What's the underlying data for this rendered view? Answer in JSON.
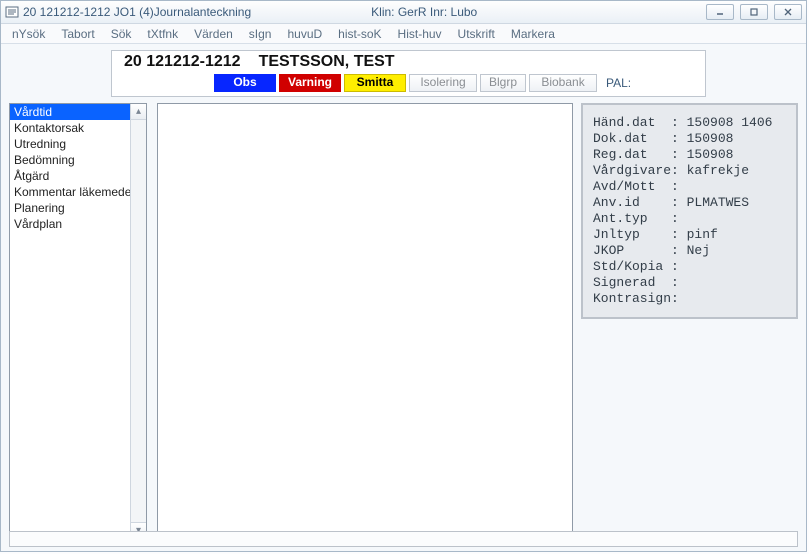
{
  "window": {
    "title": "20 121212-1212  JO1 (4)Journalanteckning",
    "klin": "Klin: GerR  Inr: Lubo"
  },
  "menu": {
    "items": [
      "nYsök",
      "Tabort",
      "Sök",
      "tXtfnk",
      "Värden",
      "sIgn",
      "huvuD",
      "hist-soK",
      "Hist-huv",
      "Utskrift",
      "Markera"
    ]
  },
  "patient": {
    "id": "20 121212-1212",
    "name": "TESTSSON, TEST",
    "tags": {
      "obs": "Obs",
      "varning": "Varning",
      "smitta": "Smitta",
      "isolering": "Isolering",
      "blgrp": "Blgrp",
      "biobank": "Biobank"
    },
    "pal_label": "PAL:"
  },
  "sidebar": {
    "items": [
      {
        "label": "Vårdtid",
        "selected": true
      },
      {
        "label": "Kontaktorsak"
      },
      {
        "label": "Utredning"
      },
      {
        "label": "Bedömning"
      },
      {
        "label": "Åtgärd"
      },
      {
        "label": "Kommentar läkemedel"
      },
      {
        "label": "Planering"
      },
      {
        "label": "Vårdplan"
      }
    ]
  },
  "meta": {
    "rows": [
      {
        "k": "Händ.dat  :",
        "v": "150908 1406"
      },
      {
        "k": "Dok.dat   :",
        "v": "150908"
      },
      {
        "k": "Reg.dat   :",
        "v": "150908"
      },
      {
        "k": "Vårdgivare:",
        "v": "kafrekje"
      },
      {
        "k": "Avd/Mott  :",
        "v": ""
      },
      {
        "k": "Anv.id    :",
        "v": "PLMATWES"
      },
      {
        "k": "Ant.typ   :",
        "v": ""
      },
      {
        "k": "Jnltyp    :",
        "v": "pinf"
      },
      {
        "k": "JKOP      :",
        "v": "Nej"
      },
      {
        "k": "Std/Kopia :",
        "v": ""
      },
      {
        "k": "Signerad  :",
        "v": ""
      },
      {
        "k": "Kontrasign:",
        "v": ""
      }
    ]
  }
}
